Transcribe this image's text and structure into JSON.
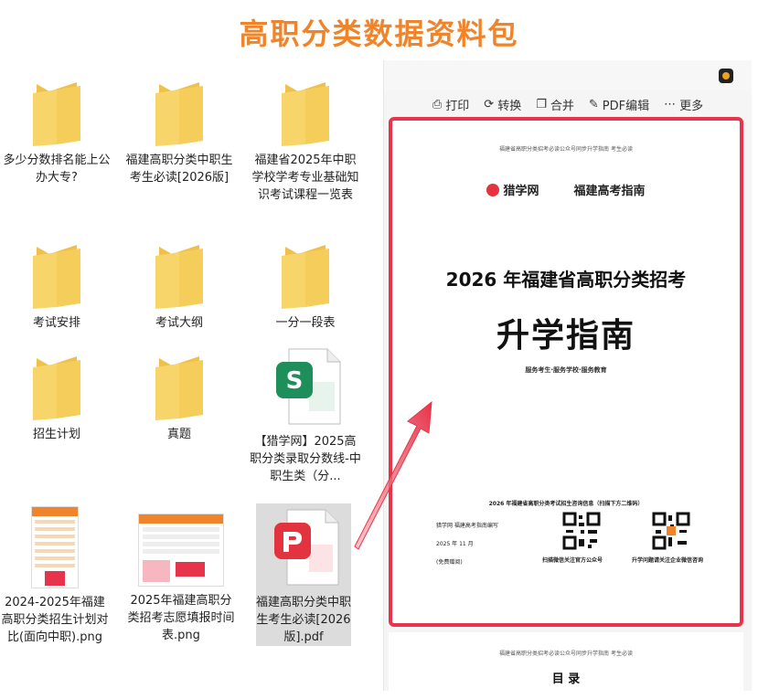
{
  "banner": {
    "title": "高职分类数据资料包"
  },
  "files": [
    {
      "label": "多少分数排名能上公办大专?",
      "type": "folder"
    },
    {
      "label": "福建高职分类中职生考生必读[2026版]",
      "type": "folder"
    },
    {
      "label": "福建省2025年中职学校学考专业基础知识考试课程一览表",
      "type": "folder"
    },
    {
      "label": "考试安排",
      "type": "folder"
    },
    {
      "label": "考试大纲",
      "type": "folder"
    },
    {
      "label": "一分一段表",
      "type": "folder"
    },
    {
      "label": "招生计划",
      "type": "folder"
    },
    {
      "label": "真题",
      "type": "folder"
    },
    {
      "label": "【猎学网】2025高职分类录取分数线-中职生类（分...",
      "type": "spreadsheet"
    },
    {
      "label": "2024-2025年福建高职分类招生计划对比(面向中职).png",
      "type": "image"
    },
    {
      "label": "2025年福建高职分类招考志愿填报时间表.png",
      "type": "image"
    },
    {
      "label": "福建高职分类中职生考生必读[2026版].pdf",
      "type": "pdf"
    }
  ],
  "viewer": {
    "toolbar": [
      "打印",
      "转换",
      "合并",
      "PDF编辑",
      "更多"
    ],
    "page": {
      "header_small": "福建省高职分类招考必读公众号同步升学指南  考生必读",
      "logo_brand": "猎学网",
      "logo_sub": "福建高考指南",
      "title_line1": "2026 年福建省高职分类招考",
      "title_line2": "升学指南",
      "slogan": "服务考生·服务学校·服务教育",
      "contact_title": "2026 年福建省高职分类考试招生咨询信息（扫描下方二维码）",
      "contact_left_1": "猎学网    福建高考指南编写",
      "contact_left_2": "2025 年 11 月",
      "contact_left_3": "(免费赠阅)",
      "qr1_caption": "扫描微信关注官方公众号",
      "qr2_caption": "升学问题请关注企业微信咨询"
    },
    "page2": {
      "header_small": "福建省高职分类招考必读公众号同步升学指南  考生必读",
      "toc_title": "目  录"
    }
  },
  "colors": {
    "banner": "#f0842a",
    "highlight": "#e8344a",
    "folder": "#f5c94d"
  }
}
